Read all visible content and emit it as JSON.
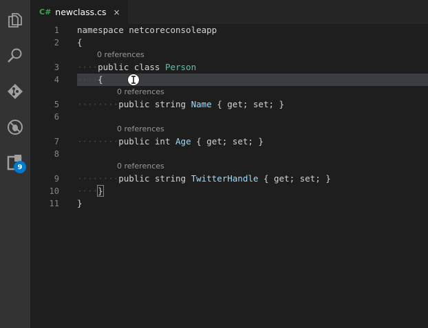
{
  "tab": {
    "lang": "C#",
    "title": "newclass.cs",
    "close": "×"
  },
  "activity": {
    "icons": [
      "explorer-icon",
      "search-icon",
      "source-control-icon",
      "debug-icon",
      "extensions-icon"
    ],
    "extensions_badge": "9"
  },
  "editor": {
    "lens_label": "0 references",
    "lines": [
      {
        "n": "1",
        "tokens": [
          [
            "kw",
            "namespace"
          ],
          [
            "punc",
            " netcoreconsoleapp"
          ]
        ]
      },
      {
        "n": "2",
        "tokens": [
          [
            "punc",
            "{"
          ]
        ]
      },
      {
        "n": "3",
        "tokens": [
          [
            "ws",
            "····"
          ],
          [
            "kw",
            "public class "
          ],
          [
            "type",
            "Person"
          ]
        ]
      },
      {
        "n": "4",
        "tokens": [
          [
            "ws",
            "····"
          ],
          [
            "punc",
            "{"
          ]
        ]
      },
      {
        "n": "5",
        "tokens": [
          [
            "ws",
            "········"
          ],
          [
            "kw",
            "public string "
          ],
          [
            "ident",
            "Name"
          ],
          [
            "punc",
            " { get; set; }"
          ]
        ]
      },
      {
        "n": "6",
        "tokens": []
      },
      {
        "n": "7",
        "tokens": [
          [
            "ws",
            "········"
          ],
          [
            "kw",
            "public int "
          ],
          [
            "ident",
            "Age"
          ],
          [
            "punc",
            " { get; set; }"
          ]
        ]
      },
      {
        "n": "8",
        "tokens": []
      },
      {
        "n": "9",
        "tokens": [
          [
            "ws",
            "········"
          ],
          [
            "kw",
            "public string "
          ],
          [
            "ident",
            "TwitterHandle"
          ],
          [
            "punc",
            " { get; set; }"
          ]
        ]
      },
      {
        "n": "10",
        "tokens": [
          [
            "ws",
            "····"
          ],
          [
            "punc",
            "}"
          ]
        ]
      },
      {
        "n": "11",
        "tokens": [
          [
            "punc",
            "}"
          ]
        ]
      }
    ]
  },
  "colors": {
    "activity_bar": "#333333",
    "editor_bg": "#1e1e1e",
    "type": "#4ec9b0",
    "identifier": "#9cdcfe",
    "badge": "#007acc"
  }
}
